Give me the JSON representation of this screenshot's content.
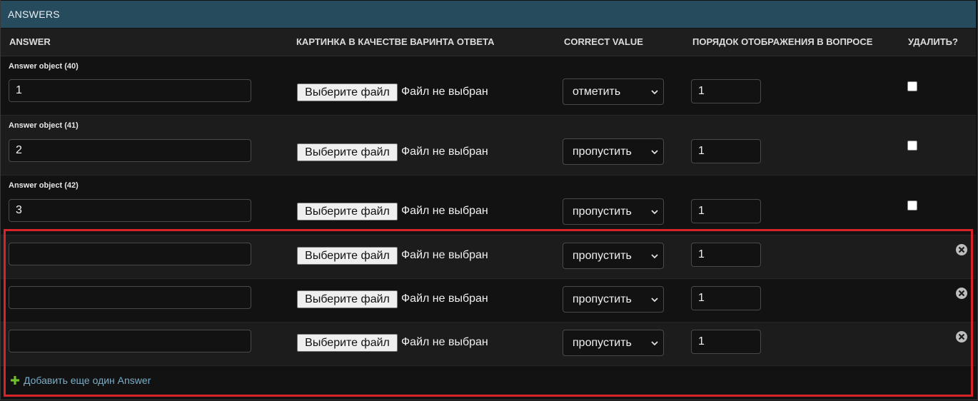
{
  "section": {
    "title": "ANSWERS"
  },
  "columns": {
    "answer": "ANSWER",
    "image": "КАРТИНКА В КАЧЕСТВЕ ВАРИНТА ОТВЕТА",
    "correct": "CORRECT VALUE",
    "order": "ПОРЯДОК ОТОБРАЖЕНИЯ В ВОПРОСЕ",
    "delete": "УДАЛИТЬ?"
  },
  "file_button_label": "Выберите файл",
  "file_status": "Файл не выбран",
  "rows": [
    {
      "label": "Answer object (40)",
      "answer": "1",
      "correct": "отметить",
      "order": "1"
    },
    {
      "label": "Answer object (41)",
      "answer": "2",
      "correct": "пропустить",
      "order": "1"
    },
    {
      "label": "Answer object (42)",
      "answer": "3",
      "correct": "пропустить",
      "order": "1"
    },
    {
      "answer": "",
      "correct": "пропустить",
      "order": "1"
    },
    {
      "answer": "",
      "correct": "пропустить",
      "order": "1"
    },
    {
      "answer": "",
      "correct": "пропустить",
      "order": "1"
    }
  ],
  "add_link": "Добавить еще один Answer",
  "colors": {
    "caption_bg": "#264b5d",
    "link": "#79aec8",
    "plus": "#70bf2b",
    "highlight": "#d9232a"
  },
  "icons": {
    "chevron": "chevron-down-icon",
    "delete": "delete-row-icon",
    "add": "plus-icon"
  }
}
